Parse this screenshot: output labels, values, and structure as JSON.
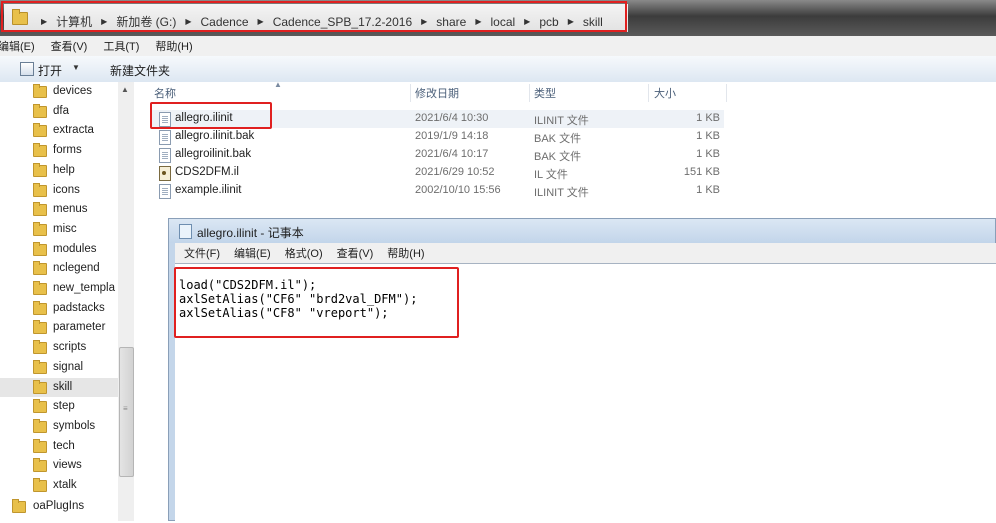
{
  "address": {
    "segments": [
      "计算机",
      "新加卷 (G:)",
      "Cadence",
      "Cadence_SPB_17.2-2016",
      "share",
      "local",
      "pcb",
      "skill"
    ]
  },
  "menu": [
    "编辑(E)",
    "查看(V)",
    "工具(T)",
    "帮助(H)"
  ],
  "toolbar": {
    "open_label": "打开",
    "new_folder_label": "新建文件夹"
  },
  "tree": {
    "items": [
      "devices",
      "dfa",
      "extracta",
      "forms",
      "help",
      "icons",
      "menus",
      "misc",
      "modules",
      "nclegend",
      "new_templa",
      "padstacks",
      "parameter",
      "scripts",
      "signal",
      "skill",
      "step",
      "symbols",
      "tech",
      "views",
      "xtalk"
    ],
    "selected": "skill",
    "root_item": "oaPlugIns"
  },
  "file_list": {
    "columns": {
      "name": "名称",
      "date": "修改日期",
      "type": "类型",
      "size": "大小"
    },
    "rows": [
      {
        "name": "allegro.ilinit",
        "date": "2021/6/4 10:30",
        "type": "ILINIT 文件",
        "size": "1 KB",
        "icon": "text-file-icon"
      },
      {
        "name": "allegro.ilinit.bak",
        "date": "2019/1/9 14:18",
        "type": "BAK 文件",
        "size": "1 KB",
        "icon": "text-file-icon"
      },
      {
        "name": "allegroilinit.bak",
        "date": "2021/6/4 10:17",
        "type": "BAK 文件",
        "size": "1 KB",
        "icon": "text-file-icon"
      },
      {
        "name": "CDS2DFM.il",
        "date": "2021/6/29 10:52",
        "type": "IL 文件",
        "size": "151 KB",
        "icon": "il-file-icon"
      },
      {
        "name": "example.ilinit",
        "date": "2002/10/10 15:56",
        "type": "ILINIT 文件",
        "size": "1 KB",
        "icon": "text-file-icon"
      }
    ]
  },
  "notepad": {
    "title": "allegro.ilinit - 记事本",
    "menu": [
      "文件(F)",
      "编辑(E)",
      "格式(O)",
      "查看(V)",
      "帮助(H)"
    ],
    "content": "load(\"CDS2DFM.il\");\naxlSetAlias(\"CF6\" \"brd2val_DFM\");\naxlSetAlias(\"CF8\" \"vreport\");"
  },
  "colors": {
    "highlight": "#e02020",
    "folder": "#e8c04a"
  }
}
